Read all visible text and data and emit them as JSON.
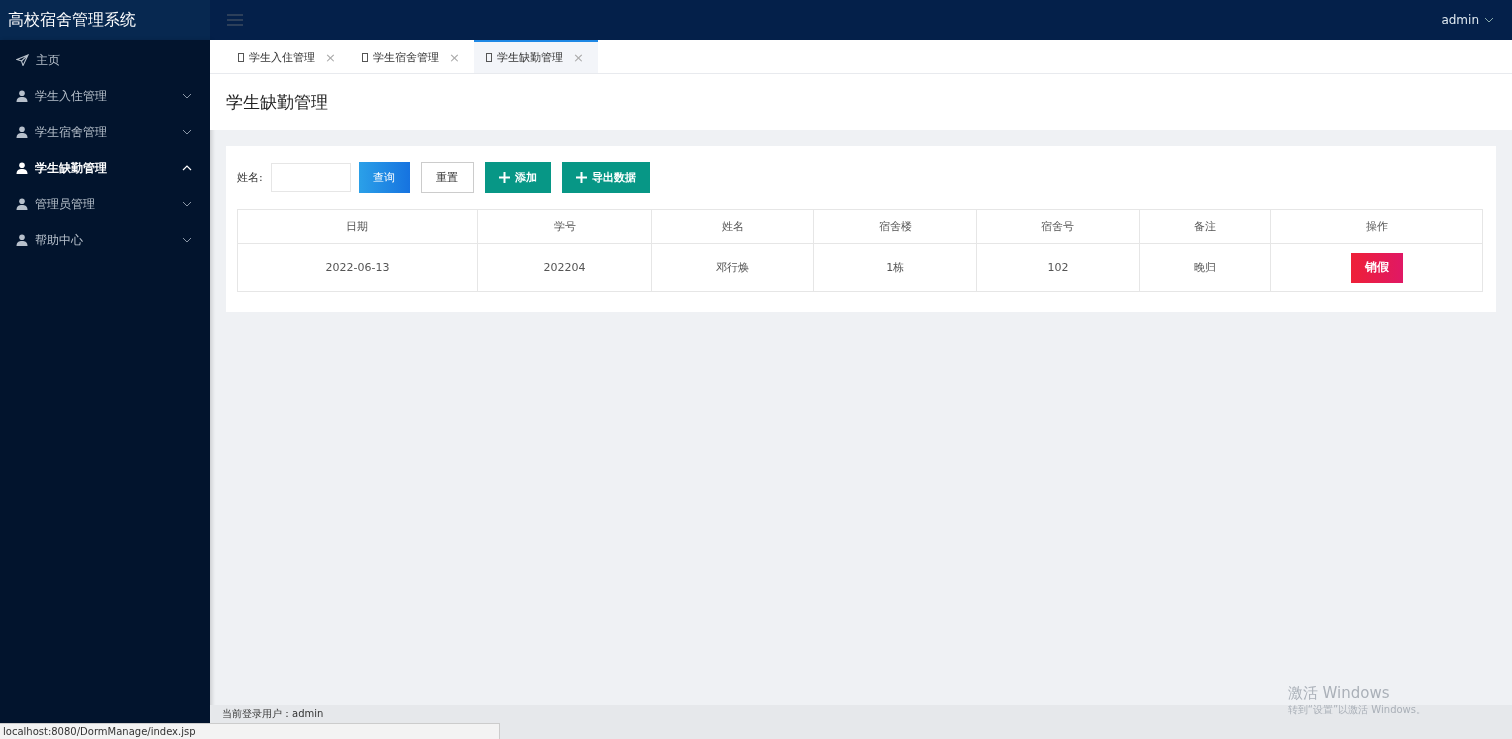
{
  "app_title": "高校宿舍管理系统",
  "user_menu": {
    "label": "admin"
  },
  "sidebar": {
    "items": [
      {
        "label": "主页",
        "kind": "home",
        "expanded": false
      },
      {
        "label": "学生入住管理",
        "kind": "group",
        "expanded": false
      },
      {
        "label": "学生宿舍管理",
        "kind": "group",
        "expanded": false
      },
      {
        "label": "学生缺勤管理",
        "kind": "group",
        "expanded": true
      },
      {
        "label": "管理员管理",
        "kind": "group",
        "expanded": false
      },
      {
        "label": "帮助中心",
        "kind": "group",
        "expanded": false
      }
    ]
  },
  "tabs": [
    {
      "label": "学生入住管理",
      "selected": false,
      "close": "×"
    },
    {
      "label": "学生宿舍管理",
      "selected": false,
      "close": "×"
    },
    {
      "label": "学生缺勤管理",
      "selected": true,
      "close": "×"
    }
  ],
  "page_title": "学生缺勤管理",
  "filter": {
    "label": "姓名:",
    "buttons": [
      {
        "label": "查询",
        "kind": "primary"
      },
      {
        "label": "重置",
        "kind": "plain"
      },
      {
        "label": "添加",
        "kind": "add"
      },
      {
        "label": "导出数据",
        "kind": "add"
      }
    ]
  },
  "table": {
    "columns": [
      "日期",
      "学号",
      "姓名",
      "宿舍楼",
      "宿舍号",
      "备注",
      "操作"
    ],
    "rows": [
      {
        "cells": [
          "2022-06-13",
          "202204",
          "邓行焕",
          "1栋",
          "102",
          "晚归"
        ],
        "action": "销假"
      }
    ]
  },
  "footer": {
    "text": "当前登录用户：admin"
  },
  "browser_status": "localhost:8080/DormManage/index.jsp",
  "os_notice": {
    "title": "激活 Windows",
    "text": "转到“设置”以激活 Windows。"
  }
}
